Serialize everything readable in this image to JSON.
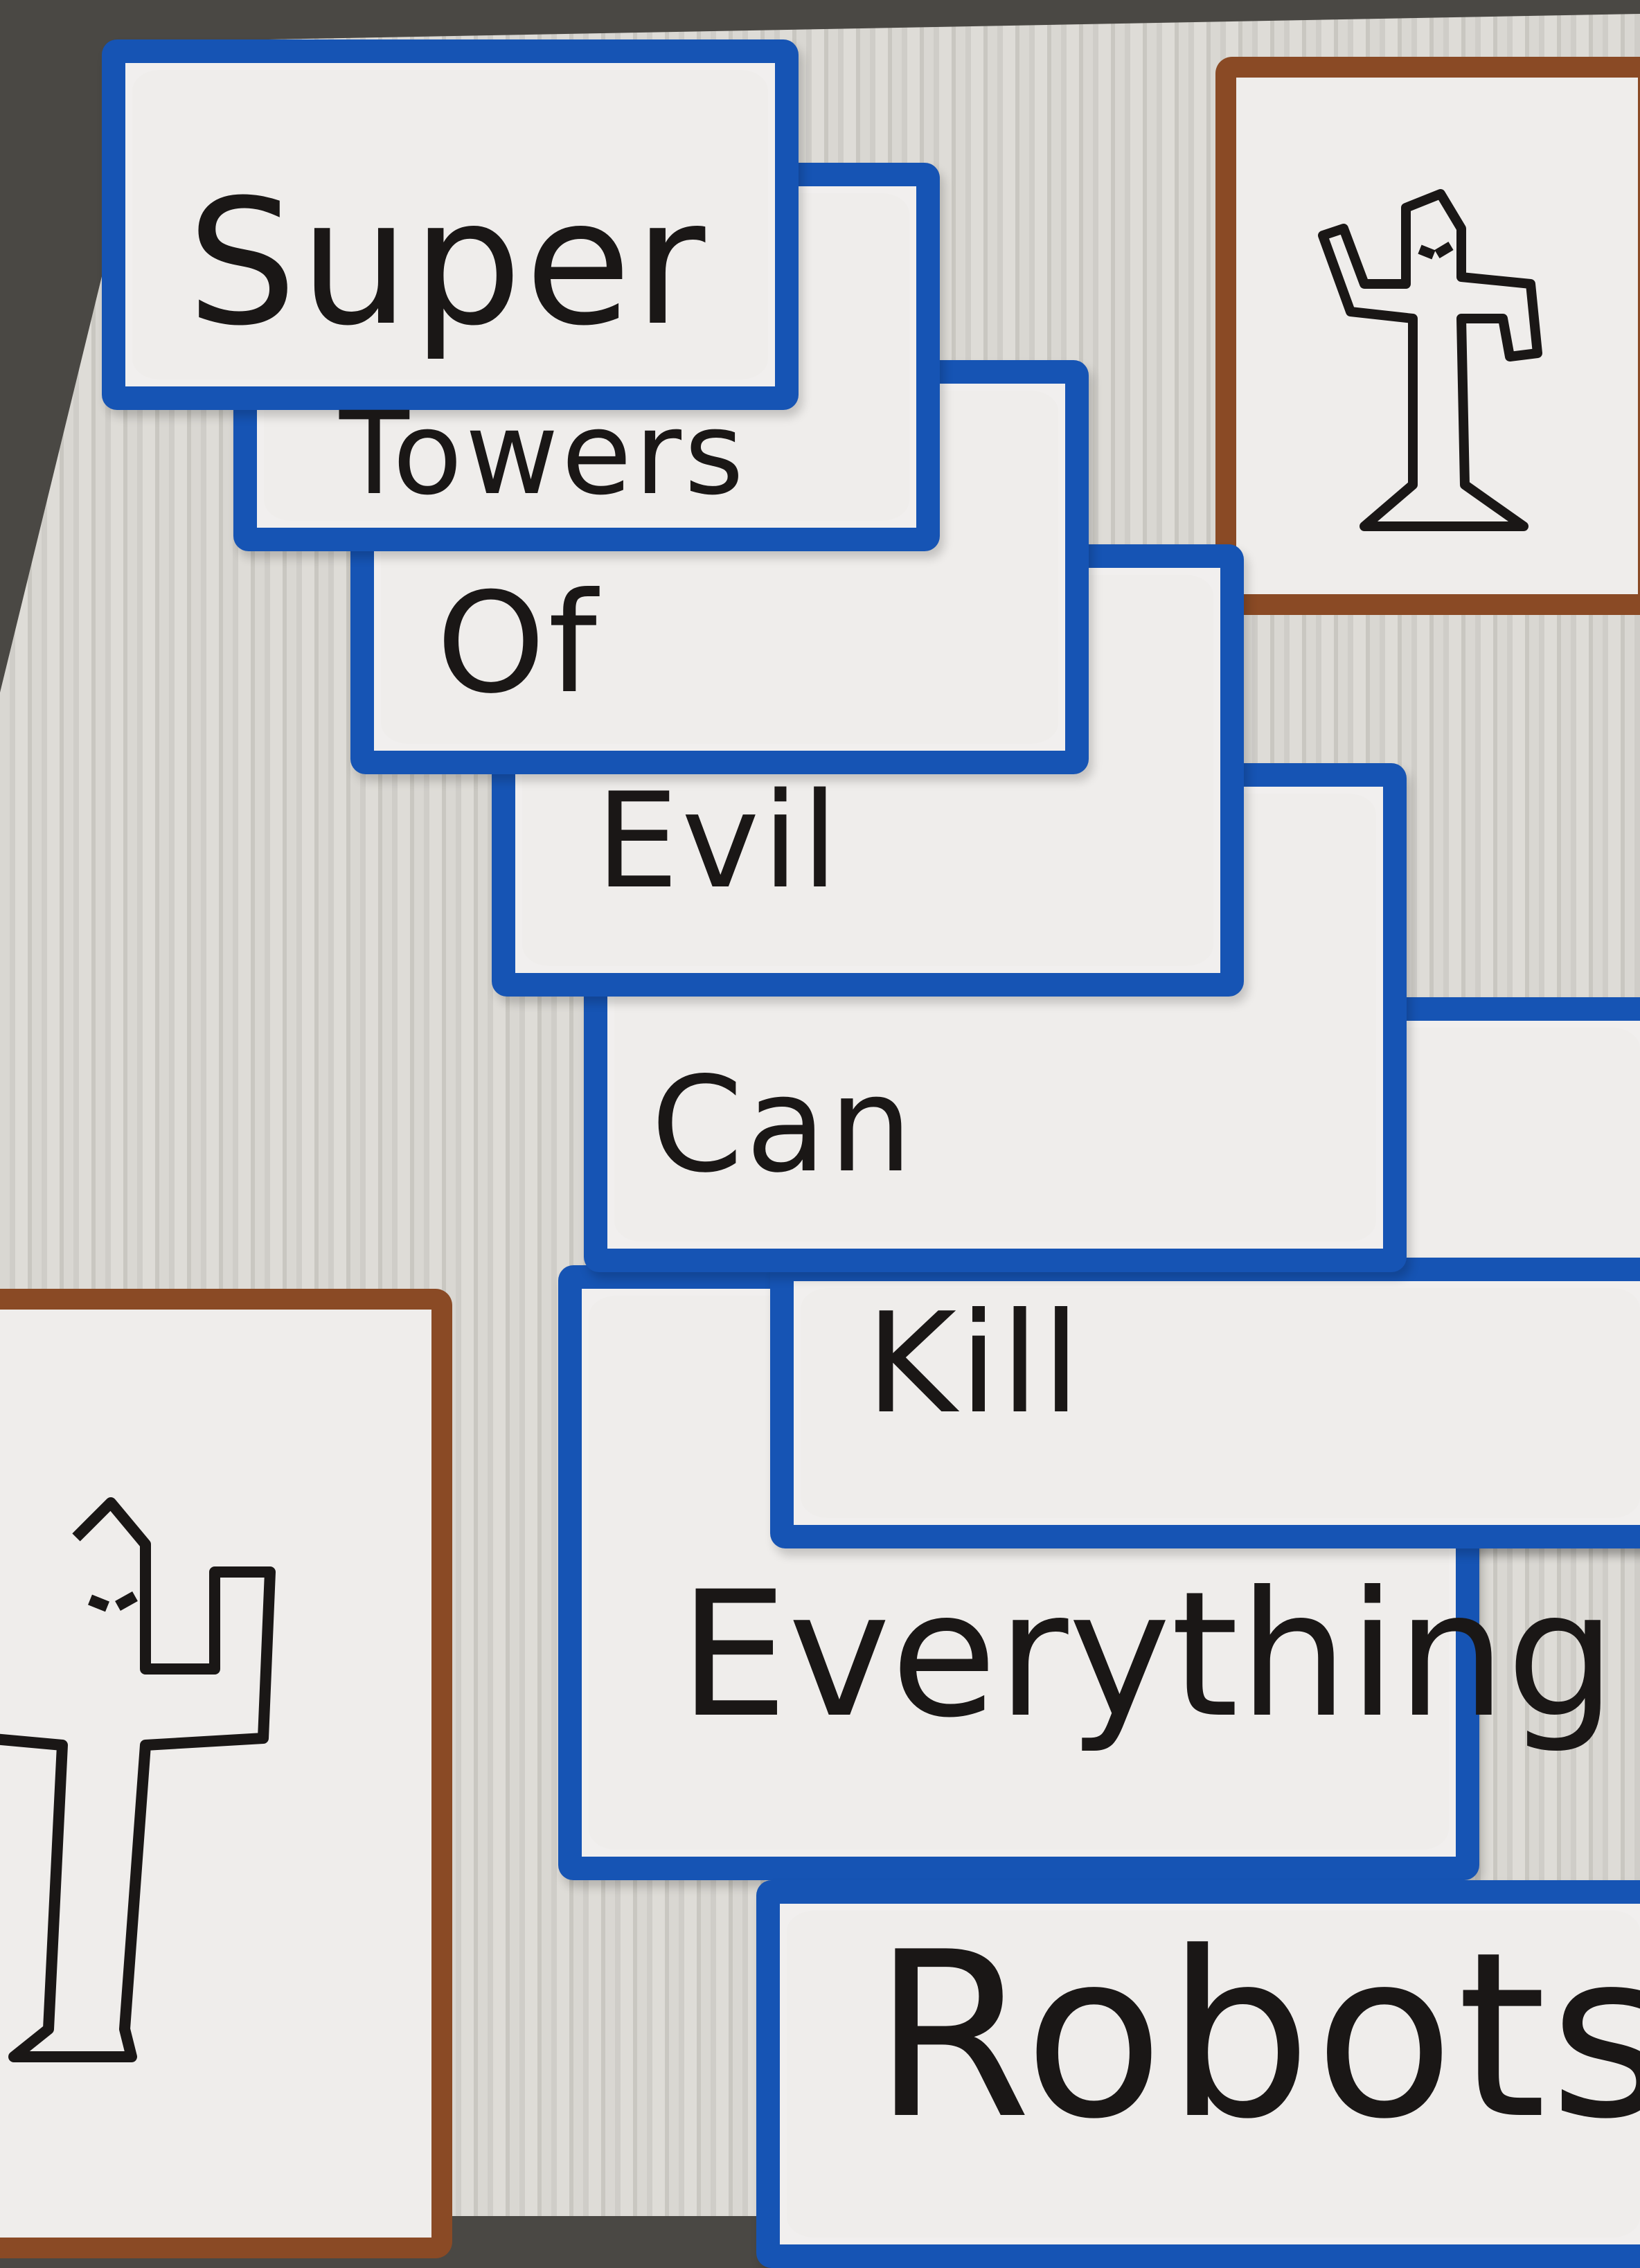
{
  "poster": {
    "words": [
      "Super",
      "Towers",
      "Of",
      "Evil",
      "Can",
      "Kill",
      "Everything",
      "Robots"
    ]
  },
  "colors": {
    "label_border": "#1654b4",
    "card_border": "#8a4a25",
    "board": "#d9d7d2",
    "ink": "#1a1716"
  },
  "icons": [
    "evil-tower-robot-drawing",
    "evil-tower-robot-drawing"
  ]
}
